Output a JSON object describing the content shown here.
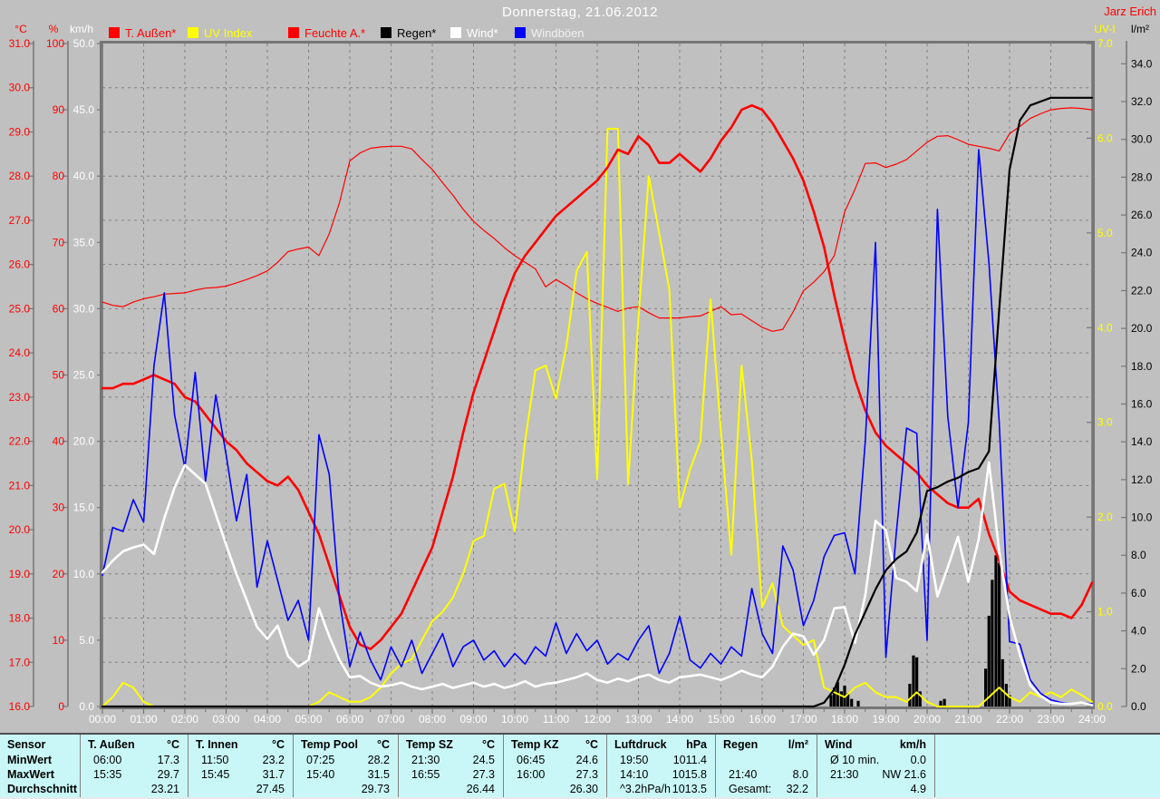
{
  "header": {
    "title": "Donnerstag, 21.06.2012",
    "signature": "Jarz Erich"
  },
  "legend": {
    "items": [
      {
        "label": "T. Außen*",
        "swatch_color": "#ff0000",
        "text_color": "#ff0000"
      },
      {
        "label": "UV Index",
        "swatch_color": "#ffff00",
        "text_color": "#ffff00"
      },
      {
        "label": "Feuchte A.*",
        "swatch_color": "#ff0000",
        "text_color": "#ff0000"
      },
      {
        "label": "Regen*",
        "swatch_color": "#000000",
        "text_color": "#000000"
      },
      {
        "label": "Wind*",
        "swatch_color": "#ffffff",
        "text_color": "#ffffff"
      },
      {
        "label": "Windböen",
        "swatch_color": "#0000ff",
        "text_color": "#f0f0f0"
      }
    ]
  },
  "chart_data": {
    "type": "line",
    "title": "Donnerstag, 21.06.2012",
    "x_unit": "hours",
    "x_start": 0,
    "x_end": 24,
    "x_step_hours": 0.25,
    "x_tick_labels": [
      "00:00",
      "01:00",
      "02:00",
      "03:00",
      "04:00",
      "05:00",
      "06:00",
      "07:00",
      "08:00",
      "09:00",
      "10:00",
      "11:00",
      "12:00",
      "13:00",
      "14:00",
      "15:00",
      "16:00",
      "17:00",
      "18:00",
      "19:00",
      "20:00",
      "21:00",
      "22:00",
      "23:00",
      "24:00"
    ],
    "grid": {
      "vertical_every_hours": 1,
      "horizontal_every_degC": 1,
      "color": "#808080",
      "style": "dashed"
    },
    "axes": [
      {
        "id": "temp",
        "header": "°C",
        "side": "left",
        "color": "#ff0000",
        "scale_top": 31,
        "scale_bottom": 16,
        "tick_labels": [
          "31.0",
          "30.0",
          "29.0",
          "28.0",
          "27.0",
          "26.0",
          "25.0",
          "24.0",
          "23.0",
          "22.0",
          "21.0",
          "20.0",
          "19.0",
          "18.0",
          "17.0",
          "16.0"
        ]
      },
      {
        "id": "hum",
        "header": "%",
        "side": "left",
        "color": "#ff0000",
        "scale_top": 100,
        "scale_bottom": 0,
        "tick_labels": [
          "100",
          "90",
          "80",
          "70",
          "60",
          "50",
          "40",
          "30",
          "20",
          "10",
          "0"
        ]
      },
      {
        "id": "wind",
        "header": "km/h",
        "side": "left",
        "color": "#ffffff",
        "scale_top": 50,
        "scale_bottom": 0,
        "tick_labels": [
          "50.0",
          "45.0",
          "40.0",
          "35.0",
          "30.0",
          "25.0",
          "20.0",
          "15.0",
          "10.0",
          "5.0",
          "0.0"
        ]
      },
      {
        "id": "uv",
        "header": "UV-I",
        "side": "right",
        "color": "#ffff00",
        "scale_top": 7,
        "scale_bottom": 0,
        "tick_labels": [
          "7.0",
          "6.0",
          "5.0",
          "4.0",
          "3.0",
          "2.0",
          "1.0",
          "0.0"
        ]
      },
      {
        "id": "rain",
        "header": "l/m²",
        "side": "right",
        "color": "#000000",
        "scale_top": 35.07,
        "scale_bottom": 0,
        "tick_labels": [
          "34.0",
          "32.0",
          "30.0",
          "28.0",
          "26.0",
          "24.0",
          "22.0",
          "20.0",
          "18.0",
          "16.0",
          "14.0",
          "12.0",
          "10.0",
          "8.0",
          "6.0",
          "4.0",
          "2.0",
          "0.0"
        ]
      }
    ],
    "series": [
      {
        "name": "Feuchte A.*",
        "axis": "hum",
        "color": "#ff0000",
        "width": 1.2,
        "values": [
          61,
          60.5,
          60.3,
          61,
          61.5,
          61.8,
          62.2,
          62.3,
          62.4,
          62.8,
          63.1,
          63.2,
          63.4,
          63.9,
          64.4,
          65,
          65.7,
          67,
          68.6,
          69,
          69.3,
          68,
          71.3,
          76,
          82.3,
          83.5,
          84.2,
          84.4,
          84.5,
          84.5,
          84.1,
          82.5,
          81,
          79,
          77.1,
          75,
          73.2,
          71.8,
          70.6,
          69.2,
          68,
          67,
          66,
          63.3,
          64.4,
          63.5,
          62.4,
          61.5,
          60.8,
          60.2,
          59.6,
          60.1,
          60.3,
          59.4,
          58.6,
          58.6,
          58.6,
          58.8,
          58.9,
          59.6,
          60.3,
          59.1,
          59.2,
          58.2,
          57.2,
          56.6,
          56.9,
          59.5,
          62.7,
          64,
          65.6,
          68,
          74.6,
          78,
          81.9,
          82,
          81.3,
          81.8,
          82.5,
          83.8,
          85.1,
          86,
          86.1,
          85.5,
          84.8,
          84.5,
          84.2,
          83.8,
          86.4,
          87.5,
          88.7,
          89.4,
          90,
          90.2,
          90.3,
          90.2,
          90
        ]
      },
      {
        "name": "UV Index",
        "axis": "uv",
        "color": "#ffff00",
        "width": 2,
        "values": [
          0,
          0.1,
          0.25,
          0.2,
          0.05,
          0,
          0,
          0,
          0,
          0,
          0,
          0,
          0,
          0,
          0,
          0,
          0,
          0,
          0,
          0,
          0,
          0.05,
          0.15,
          0.1,
          0.05,
          0.05,
          0.1,
          0.2,
          0.35,
          0.45,
          0.5,
          0.7,
          0.9,
          1.0,
          1.15,
          1.4,
          1.75,
          1.8,
          2.3,
          2.35,
          1.85,
          2.8,
          3.55,
          3.6,
          3.25,
          3.8,
          4.6,
          4.8,
          2.4,
          6.1,
          6.1,
          2.35,
          4.1,
          5.6,
          5.0,
          4.4,
          2.1,
          2.5,
          2.8,
          4.3,
          2.9,
          1.6,
          3.6,
          2.6,
          1.05,
          1.3,
          0.85,
          0.75,
          0.65,
          0.7,
          0.2,
          0.15,
          0.1,
          0.2,
          0.25,
          0.15,
          0.1,
          0.1,
          0.05,
          0.15,
          0.05,
          0,
          0,
          0,
          0,
          0,
          0.1,
          0.2,
          0.1,
          0.05,
          0.15,
          0.1,
          0.15,
          0.1,
          0.18,
          0.12,
          0.05
        ]
      },
      {
        "name": "T. Außen*",
        "axis": "temp",
        "color": "#ff0000",
        "width": 2.6,
        "values": [
          23.2,
          23.2,
          23.3,
          23.3,
          23.4,
          23.5,
          23.4,
          23.3,
          23.0,
          22.9,
          22.6,
          22.3,
          22.0,
          21.8,
          21.5,
          21.3,
          21.1,
          21.0,
          21.2,
          20.9,
          20.4,
          19.9,
          19.2,
          18.5,
          17.8,
          17.4,
          17.3,
          17.5,
          17.8,
          18.1,
          18.6,
          19.1,
          19.6,
          20.4,
          21.2,
          22.2,
          23.1,
          23.8,
          24.5,
          25.2,
          25.8,
          26.2,
          26.5,
          26.8,
          27.1,
          27.3,
          27.5,
          27.7,
          27.9,
          28.2,
          28.6,
          28.5,
          28.9,
          28.7,
          28.3,
          28.3,
          28.5,
          28.3,
          28.1,
          28.4,
          28.8,
          29.1,
          29.5,
          29.6,
          29.5,
          29.2,
          28.8,
          28.4,
          27.9,
          27.2,
          26.4,
          25.3,
          24.3,
          23.4,
          22.7,
          22.2,
          21.9,
          21.7,
          21.5,
          21.3,
          21.0,
          20.8,
          20.6,
          20.5,
          20.5,
          20.7,
          19.9,
          19.3,
          18.6,
          18.4,
          18.3,
          18.2,
          18.1,
          18.1,
          18.0,
          18.3,
          18.8
        ]
      },
      {
        "name": "Windböen",
        "axis": "wind",
        "color": "#0000ff",
        "width": 1.6,
        "values": [
          9.9,
          13.5,
          13.2,
          15.6,
          13.9,
          25.7,
          31.2,
          22,
          18,
          25.2,
          17,
          23.5,
          19,
          14,
          17.5,
          9,
          12.5,
          9.5,
          6.5,
          8,
          5,
          20.5,
          17.5,
          8,
          3,
          5.6,
          3.5,
          2,
          4.5,
          3,
          5,
          2.5,
          4,
          5.5,
          3,
          4.5,
          5,
          3.5,
          4.2,
          3.0,
          4.0,
          3.2,
          4.5,
          3.8,
          6.3,
          4.0,
          5.5,
          4.2,
          5.0,
          3.2,
          4.0,
          3.5,
          5.0,
          6.1,
          2.5,
          4.0,
          6.8,
          3.5,
          2.9,
          4.0,
          3.2,
          4.5,
          3.8,
          8.9,
          5.5,
          4.0,
          12.1,
          10.3,
          6.1,
          8.0,
          11.3,
          12.9,
          13.1,
          10.0,
          20,
          35,
          3.7,
          13,
          21,
          20.6,
          5,
          37.5,
          21.9,
          15,
          21.4,
          42,
          33.4,
          21.4,
          4.9,
          4.7,
          2,
          1,
          0.5,
          0.3,
          0.2,
          0.3,
          0.2
        ]
      },
      {
        "name": "Wind*",
        "axis": "wind",
        "color": "#ffffff",
        "width": 2.6,
        "values": [
          10.1,
          11,
          11.7,
          12,
          12.2,
          11.5,
          14.2,
          16.5,
          18.2,
          17.5,
          16.8,
          14.5,
          12.2,
          10,
          8,
          6,
          5.1,
          6.1,
          3.8,
          3.0,
          3.5,
          7.4,
          5.3,
          3.5,
          2.2,
          2.3,
          1.8,
          1.5,
          1.6,
          1.8,
          1.5,
          1.3,
          1.5,
          1.7,
          1.4,
          1.6,
          1.8,
          1.5,
          1.7,
          1.4,
          1.6,
          1.9,
          1.5,
          1.7,
          1.8,
          2.0,
          2.2,
          2.5,
          2.0,
          1.8,
          2.1,
          1.9,
          2.2,
          2.4,
          2.0,
          1.8,
          2.2,
          2.3,
          2.4,
          2.2,
          2.0,
          2.3,
          2.7,
          2.4,
          2.2,
          3.0,
          4.5,
          5.5,
          5.3,
          3.9,
          5.0,
          7.4,
          7.5,
          4.8,
          8.4,
          14.0,
          13.3,
          9.7,
          9.4,
          8.7,
          13.0,
          8.3,
          10.5,
          12.8,
          9.4,
          12.6,
          18.4,
          11.7,
          6.8,
          3.9,
          1.6,
          0.8,
          0.3,
          0.2,
          0.2,
          0.3,
          0.1
        ]
      },
      {
        "name": "Regen*",
        "axis": "rain",
        "color": "#000000",
        "width": 2.2,
        "values": [
          0,
          0,
          0,
          0,
          0,
          0,
          0,
          0,
          0,
          0,
          0,
          0,
          0,
          0,
          0,
          0,
          0,
          0,
          0,
          0,
          0,
          0,
          0,
          0,
          0,
          0,
          0,
          0,
          0,
          0,
          0,
          0,
          0,
          0,
          0,
          0,
          0,
          0,
          0,
          0,
          0,
          0,
          0,
          0,
          0,
          0,
          0,
          0,
          0,
          0,
          0,
          0,
          0,
          0,
          0,
          0,
          0,
          0,
          0,
          0,
          0,
          0,
          0,
          0,
          0,
          0,
          0,
          0,
          0,
          0,
          0.2,
          0.9,
          2.2,
          3.8,
          5.0,
          6.2,
          7.2,
          7.8,
          8.2,
          9.2,
          11.4,
          11.6,
          11.9,
          12.1,
          12.4,
          12.6,
          13.5,
          21.0,
          28.4,
          31.0,
          31.8,
          32.0,
          32.2,
          32.2,
          32.2,
          32.2,
          32.2
        ]
      }
    ],
    "rain_bars": [
      [
        17.67,
        0.6
      ],
      [
        17.75,
        1.0
      ],
      [
        17.83,
        1.3
      ],
      [
        17.92,
        0.8
      ],
      [
        18.0,
        1.1
      ],
      [
        18.08,
        0.7
      ],
      [
        18.17,
        0.4
      ],
      [
        18.33,
        0.3
      ],
      [
        19.58,
        1.2
      ],
      [
        19.67,
        2.7
      ],
      [
        19.75,
        2.6
      ],
      [
        19.83,
        0.8
      ],
      [
        20.33,
        0.3
      ],
      [
        20.42,
        0.4
      ],
      [
        21.42,
        2.0
      ],
      [
        21.5,
        4.8
      ],
      [
        21.58,
        6.7
      ],
      [
        21.67,
        8.0
      ],
      [
        21.75,
        7.6
      ],
      [
        21.83,
        2.5
      ],
      [
        21.92,
        1.2
      ],
      [
        22.0,
        0.6
      ]
    ]
  },
  "table": {
    "row_labels": [
      "Sensor",
      "MinWert",
      "MaxWert",
      "Durchschnitt"
    ],
    "columns": [
      {
        "name": "T. Außen",
        "unit": "°C",
        "min": [
          "06:00",
          "17.3"
        ],
        "max": [
          "15:35",
          "29.7"
        ],
        "avg": [
          "",
          "23.21"
        ]
      },
      {
        "name": "T. Innen",
        "unit": "°C",
        "min": [
          "11:50",
          "23.2"
        ],
        "max": [
          "15:45",
          "31.7"
        ],
        "avg": [
          "",
          "27.45"
        ]
      },
      {
        "name": "Temp Pool",
        "unit": "°C",
        "min": [
          "07:25",
          "28.2"
        ],
        "max": [
          "15:40",
          "31.5"
        ],
        "avg": [
          "",
          "29.73"
        ]
      },
      {
        "name": "Temp SZ",
        "unit": "°C",
        "min": [
          "21:30",
          "24.5"
        ],
        "max": [
          "16:55",
          "27.3"
        ],
        "avg": [
          "",
          "26.44"
        ]
      },
      {
        "name": "Temp KZ",
        "unit": "°C",
        "min": [
          "06:45",
          "24.6"
        ],
        "max": [
          "16:00",
          "27.3"
        ],
        "avg": [
          "",
          "26.30"
        ]
      },
      {
        "name": "Luftdruck",
        "unit": "hPa",
        "min": [
          "19:50",
          "1011.4"
        ],
        "max": [
          "14:10",
          "1015.8"
        ],
        "avg": [
          "^3.2hPa/h",
          "1013.5"
        ]
      },
      {
        "name": "Regen",
        "unit": "l/m²",
        "min": [
          "",
          ""
        ],
        "max": [
          "21:40",
          "8.0"
        ],
        "avg": [
          "Gesamt:",
          "32.2"
        ]
      },
      {
        "name": "Wind",
        "unit": "km/h",
        "min": [
          "Ø 10 min.",
          "0.0"
        ],
        "max": [
          "21:30",
          "NW 21.6"
        ],
        "avg": [
          "",
          "4.9"
        ]
      }
    ]
  }
}
